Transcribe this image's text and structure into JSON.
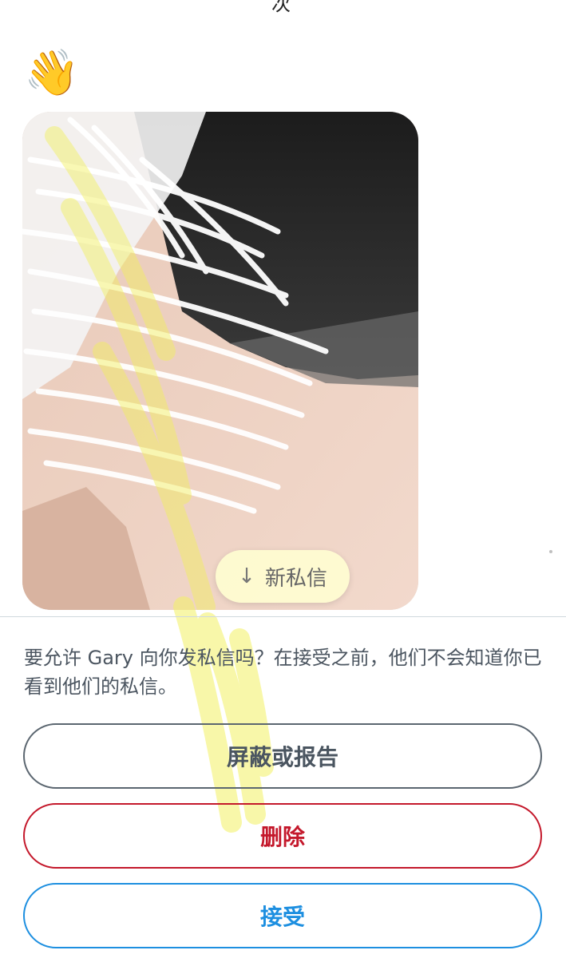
{
  "header": {
    "partial_title": "次"
  },
  "message": {
    "wave_emoji": "👋",
    "media_card": {
      "description_icon": "image"
    }
  },
  "new_message_pill": {
    "arrow": "↓",
    "label": "新私信"
  },
  "request": {
    "text": "要允许 Gary 向你发私信吗？在接受之前，他们不会知道你已看到他们的私信。"
  },
  "actions": {
    "block_report_label": "屏蔽或报告",
    "delete_label": "删除",
    "accept_label": "接受"
  },
  "colors": {
    "block_border": "#5b6670",
    "delete": "#c4182b",
    "accept": "#1d8fe0",
    "divider": "#cfd9de"
  }
}
